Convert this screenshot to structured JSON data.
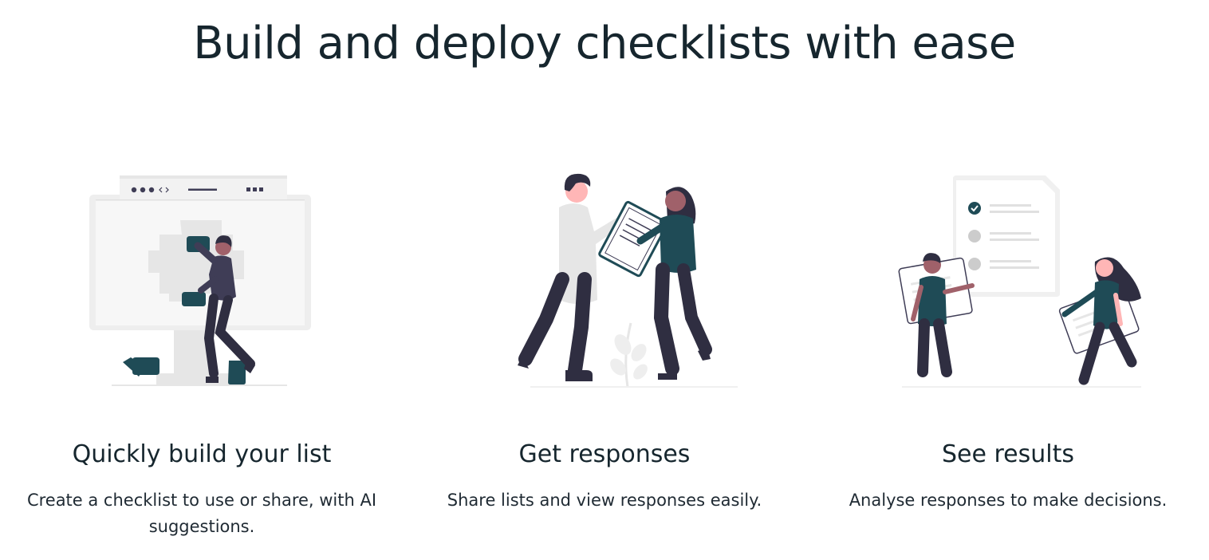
{
  "headline": "Build and deploy checklists with ease",
  "colors": {
    "accent": "#1f4b56",
    "dark_figure": "#2f2e41",
    "light_gray": "#e6e6e6",
    "mid_gray": "#cccccc",
    "skin_light": "#ffb6b6",
    "skin_dark": "#a0616a",
    "text_dark": "#16262e"
  },
  "features": [
    {
      "title": "Quickly build your list",
      "description": "Create a checklist to use or share, with AI suggestions.",
      "illustration": "person-assembling-blocks-on-monitor-illustration"
    },
    {
      "title": "Get responses",
      "description": "Share lists and view responses easily.",
      "illustration": "two-people-sharing-clipboard-illustration"
    },
    {
      "title": "See results",
      "description": "Analyse responses to make decisions.",
      "illustration": "people-carrying-checklist-cards-illustration"
    }
  ]
}
